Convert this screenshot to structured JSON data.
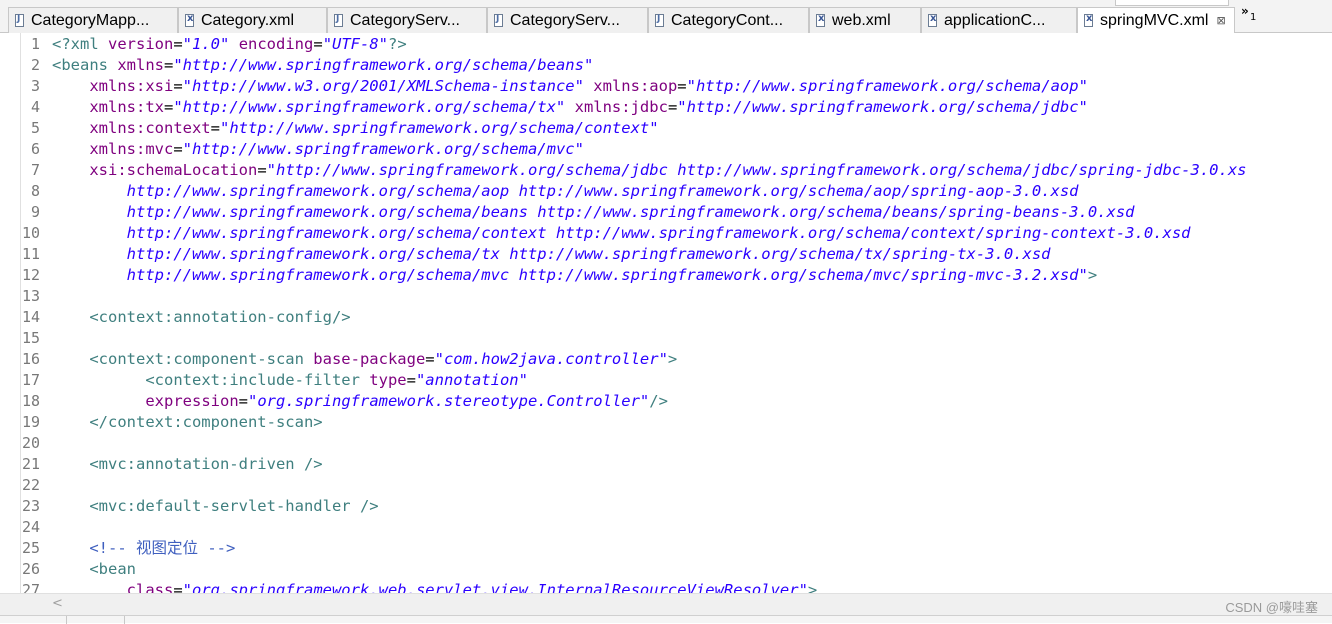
{
  "tabs": [
    {
      "label": "CategoryMapp...",
      "icon": "java-file-icon",
      "active": false
    },
    {
      "label": "Category.xml",
      "icon": "xml-file-icon",
      "active": false
    },
    {
      "label": "CategoryServ...",
      "icon": "java-file-icon",
      "active": false
    },
    {
      "label": "CategoryServ...",
      "icon": "java-file-icon",
      "active": false
    },
    {
      "label": "CategoryCont...",
      "icon": "java-file-icon",
      "active": false
    },
    {
      "label": "web.xml",
      "icon": "xml-file-icon",
      "active": false
    },
    {
      "label": "applicationC...",
      "icon": "xml-file-icon",
      "active": false
    },
    {
      "label": "springMVC.xml",
      "icon": "xml-file-icon",
      "active": true,
      "close": "⊠"
    }
  ],
  "tab_overflow": {
    "chevron": "»",
    "count": "1"
  },
  "colors": {
    "tag": "#3f7f7f",
    "attribute": "#7f007f",
    "string": "#2a00ff",
    "comment": "#3f5fbf",
    "line_number": "#787878"
  },
  "editor": {
    "lines": [
      {
        "n": "1",
        "tokens": [
          [
            "pi",
            "<?xml "
          ],
          [
            "attr",
            "version"
          ],
          [
            "txt",
            "="
          ],
          [
            "str",
            "\"1.0\""
          ],
          [
            "txt",
            " "
          ],
          [
            "attr",
            "encoding"
          ],
          [
            "txt",
            "="
          ],
          [
            "str",
            "\"UTF-8\""
          ],
          [
            "pi",
            "?>"
          ]
        ]
      },
      {
        "n": "2",
        "tokens": [
          [
            "tag",
            "<beans "
          ],
          [
            "attr",
            "xmlns"
          ],
          [
            "txt",
            "="
          ],
          [
            "str",
            "\"http://www.springframework.org/schema/beans\""
          ]
        ]
      },
      {
        "n": "3",
        "tokens": [
          [
            "txt",
            "    "
          ],
          [
            "attr",
            "xmlns:xsi"
          ],
          [
            "txt",
            "="
          ],
          [
            "str",
            "\"http://www.w3.org/2001/XMLSchema-instance\""
          ],
          [
            "txt",
            " "
          ],
          [
            "attr",
            "xmlns:aop"
          ],
          [
            "txt",
            "="
          ],
          [
            "str",
            "\"http://www.springframework.org/schema/aop\""
          ]
        ]
      },
      {
        "n": "4",
        "tokens": [
          [
            "txt",
            "    "
          ],
          [
            "attr",
            "xmlns:tx"
          ],
          [
            "txt",
            "="
          ],
          [
            "str",
            "\"http://www.springframework.org/schema/tx\""
          ],
          [
            "txt",
            " "
          ],
          [
            "attr",
            "xmlns:jdbc"
          ],
          [
            "txt",
            "="
          ],
          [
            "str",
            "\"http://www.springframework.org/schema/jdbc\""
          ]
        ]
      },
      {
        "n": "5",
        "tokens": [
          [
            "txt",
            "    "
          ],
          [
            "attr",
            "xmlns:context"
          ],
          [
            "txt",
            "="
          ],
          [
            "str",
            "\"http://www.springframework.org/schema/context\""
          ]
        ]
      },
      {
        "n": "6",
        "tokens": [
          [
            "txt",
            "    "
          ],
          [
            "attr",
            "xmlns:mvc"
          ],
          [
            "txt",
            "="
          ],
          [
            "str",
            "\"http://www.springframework.org/schema/mvc\""
          ]
        ]
      },
      {
        "n": "7",
        "tokens": [
          [
            "txt",
            "    "
          ],
          [
            "attr",
            "xsi:schemaLocation"
          ],
          [
            "txt",
            "="
          ],
          [
            "str",
            "\"http://www.springframework.org/schema/jdbc http://www.springframework.org/schema/jdbc/spring-jdbc-3.0.xs"
          ]
        ]
      },
      {
        "n": "8",
        "tokens": [
          [
            "str",
            "        http://www.springframework.org/schema/aop http://www.springframework.org/schema/aop/spring-aop-3.0.xsd"
          ]
        ]
      },
      {
        "n": "9",
        "tokens": [
          [
            "str",
            "        http://www.springframework.org/schema/beans http://www.springframework.org/schema/beans/spring-beans-3.0.xsd"
          ]
        ]
      },
      {
        "n": "10",
        "tokens": [
          [
            "str",
            "        http://www.springframework.org/schema/context http://www.springframework.org/schema/context/spring-context-3.0.xsd"
          ]
        ]
      },
      {
        "n": "11",
        "tokens": [
          [
            "str",
            "        http://www.springframework.org/schema/tx http://www.springframework.org/schema/tx/spring-tx-3.0.xsd"
          ]
        ]
      },
      {
        "n": "12",
        "tokens": [
          [
            "str",
            "        http://www.springframework.org/schema/mvc http://www.springframework.org/schema/mvc/spring-mvc-3.2.xsd\""
          ],
          [
            "tag",
            ">"
          ]
        ]
      },
      {
        "n": "13",
        "tokens": []
      },
      {
        "n": "14",
        "tokens": [
          [
            "txt",
            "    "
          ],
          [
            "tag",
            "<context:annotation-config/>"
          ]
        ]
      },
      {
        "n": "15",
        "tokens": []
      },
      {
        "n": "16",
        "tokens": [
          [
            "txt",
            "    "
          ],
          [
            "tag",
            "<context:component-scan "
          ],
          [
            "attr",
            "base-package"
          ],
          [
            "txt",
            "="
          ],
          [
            "str",
            "\"com.how2java.controller\""
          ],
          [
            "tag",
            ">"
          ]
        ]
      },
      {
        "n": "17",
        "tokens": [
          [
            "txt",
            "          "
          ],
          [
            "tag",
            "<context:include-filter "
          ],
          [
            "attr",
            "type"
          ],
          [
            "txt",
            "="
          ],
          [
            "str",
            "\"annotation\""
          ]
        ]
      },
      {
        "n": "18",
        "tokens": [
          [
            "txt",
            "          "
          ],
          [
            "attr",
            "expression"
          ],
          [
            "txt",
            "="
          ],
          [
            "str",
            "\"org.springframework.stereotype.Controller\""
          ],
          [
            "tag",
            "/>"
          ]
        ]
      },
      {
        "n": "19",
        "tokens": [
          [
            "txt",
            "    "
          ],
          [
            "tag",
            "</context:component-scan>"
          ]
        ]
      },
      {
        "n": "20",
        "tokens": []
      },
      {
        "n": "21",
        "tokens": [
          [
            "txt",
            "    "
          ],
          [
            "tag",
            "<mvc:annotation-driven />"
          ]
        ]
      },
      {
        "n": "22",
        "tokens": []
      },
      {
        "n": "23",
        "tokens": [
          [
            "txt",
            "    "
          ],
          [
            "tag",
            "<mvc:default-servlet-handler />"
          ]
        ]
      },
      {
        "n": "24",
        "tokens": []
      },
      {
        "n": "25",
        "tokens": [
          [
            "txt",
            "    "
          ],
          [
            "cmt",
            "<!-- 视图定位 -->"
          ]
        ]
      },
      {
        "n": "26",
        "tokens": [
          [
            "txt",
            "    "
          ],
          [
            "tag",
            "<bean"
          ]
        ]
      },
      {
        "n": "27",
        "tokens": [
          [
            "txt",
            "        "
          ],
          [
            "attr",
            "class"
          ],
          [
            "txt",
            "="
          ],
          [
            "str",
            "\"org.springframework.web.servlet.view.InternalResourceViewResolver\""
          ],
          [
            "tag",
            ">"
          ]
        ]
      }
    ]
  },
  "scrollbar": {
    "left_arrow": "<"
  },
  "watermark": "CSDN @嚎哇塞"
}
